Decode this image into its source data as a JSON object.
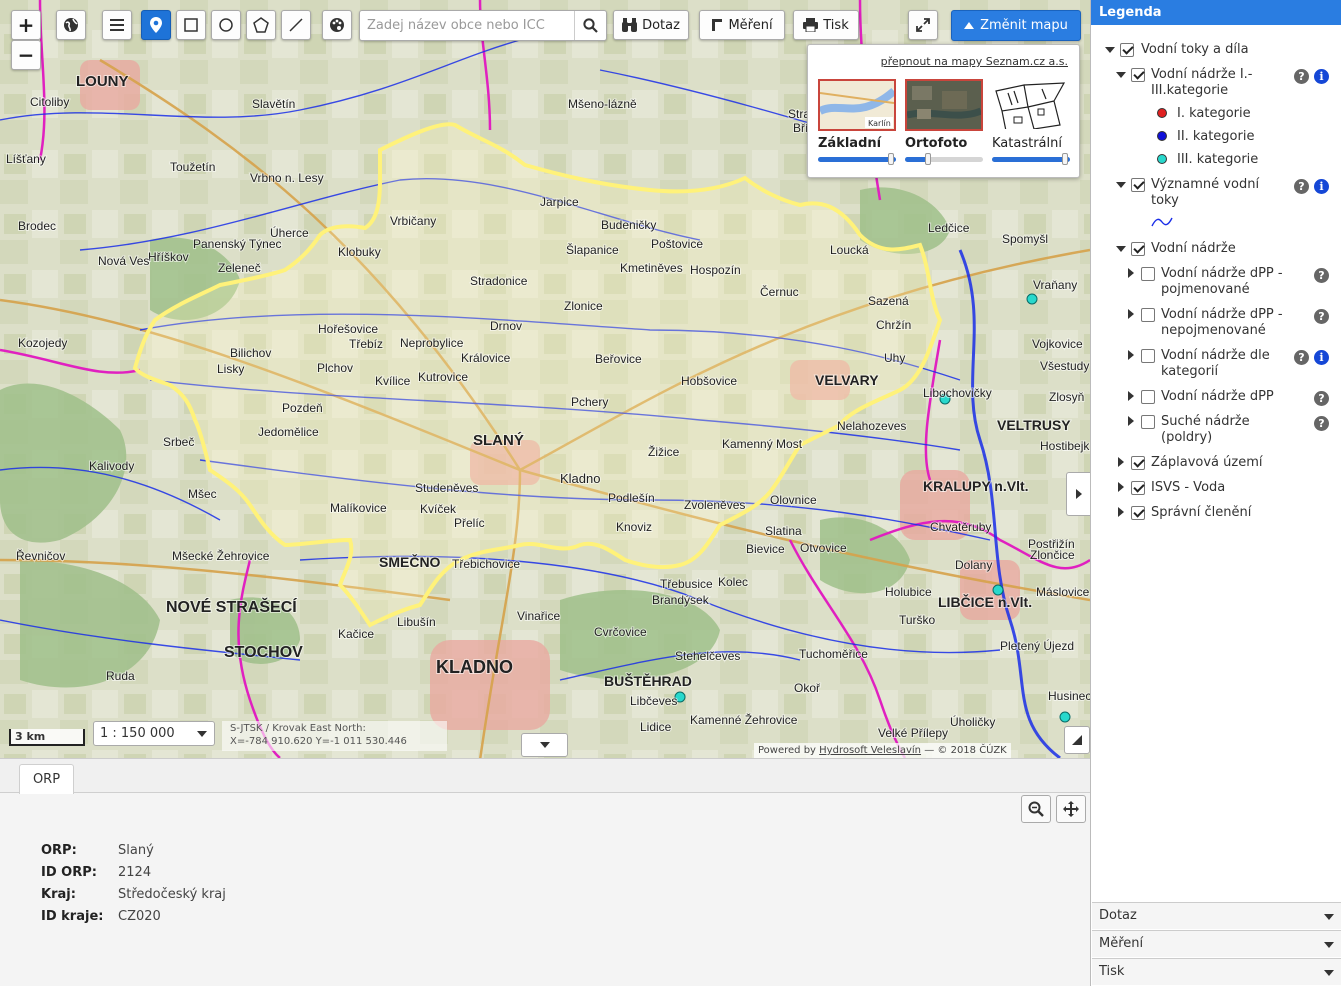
{
  "toolbar": {
    "zoom_in": "+",
    "zoom_out": "−",
    "search_placeholder": "Zadej název obce nebo ICC",
    "query_label": "Dotaz",
    "measure_label": "Měření",
    "print_label": "Tisk",
    "change_map_label": "Změnit mapu"
  },
  "map_switcher": {
    "link": "přepnout na mapy Seznam.cz a.s.",
    "options": [
      {
        "name": "Základní",
        "selected": true,
        "opacity": 1.0,
        "thumb_label": "Karlín"
      },
      {
        "name": "Ortofoto",
        "selected": true,
        "opacity": 0.2
      },
      {
        "name": "Katastrální",
        "selected": false,
        "opacity": 1.0
      }
    ]
  },
  "map": {
    "scale_bar": "3 km",
    "scale": "1 : 150 000",
    "coords_line1": "S-JTSK / Krovak East North:",
    "coords_line2": "X=-784 910.620 Y=-1 011 530.446",
    "powered_prefix": "Powered by",
    "powered_link": "Hydrosoft Veleslavín",
    "powered_suffix": "— © 2018 ČÚZK",
    "place_labels": [
      {
        "text": "LOUNY"
      },
      {
        "text": "Citoliby"
      },
      {
        "text": "Líšťany"
      },
      {
        "text": "Slavětín"
      },
      {
        "text": "Vrbno n. Lesy"
      },
      {
        "text": "Toužetín"
      },
      {
        "text": "Panenský Týnec"
      },
      {
        "text": "Hříškov"
      },
      {
        "text": "Nová Ves"
      },
      {
        "text": "Úherce"
      },
      {
        "text": "Klobuky"
      },
      {
        "text": "Zeleneč"
      },
      {
        "text": "Vrbičany"
      },
      {
        "text": "Jarpice"
      },
      {
        "text": "Šlapanice"
      },
      {
        "text": "Poštovice"
      },
      {
        "text": "Hospozín"
      },
      {
        "text": "Kmetiněves"
      },
      {
        "text": "Loucká"
      },
      {
        "text": "Černuc"
      },
      {
        "text": "Sazená"
      },
      {
        "text": "Chržín"
      },
      {
        "text": "Zlonice"
      },
      {
        "text": "Stradonice"
      },
      {
        "text": "Hořešovice"
      },
      {
        "text": "Neprobylice"
      },
      {
        "text": "Bilichov"
      },
      {
        "text": "Třebíz"
      },
      {
        "text": "Královice"
      },
      {
        "text": "Beřovice"
      },
      {
        "text": "Hobšovice"
      },
      {
        "text": "Pchery"
      },
      {
        "text": "VELVARY"
      },
      {
        "text": "Kvílice"
      },
      {
        "text": "Kutrovice"
      },
      {
        "text": "Pozdeň"
      },
      {
        "text": "Jedomělice"
      },
      {
        "text": "SLANÝ"
      },
      {
        "text": "Kamenný Most"
      },
      {
        "text": "Žižice"
      },
      {
        "text": "Kladno"
      },
      {
        "text": "Podlešín"
      },
      {
        "text": "Zvoleněves"
      },
      {
        "text": "Olovnice"
      },
      {
        "text": "Malíkovice"
      },
      {
        "text": "Studeněves"
      },
      {
        "text": "Přelíc"
      },
      {
        "text": "Kvíček"
      },
      {
        "text": "Knoviz"
      },
      {
        "text": "SMEČNO"
      },
      {
        "text": "Třebichovice"
      },
      {
        "text": "Libušín"
      },
      {
        "text": "Slatina"
      },
      {
        "text": "Otvovice"
      },
      {
        "text": "Bievice"
      },
      {
        "text": "NOVÉ STRAŠECÍ"
      },
      {
        "text": "STOCHOV"
      },
      {
        "text": "KLADNO"
      },
      {
        "text": "BUŠTĚHRAD"
      },
      {
        "text": "Třebusice"
      },
      {
        "text": "Brandýsek"
      },
      {
        "text": "Kolec"
      },
      {
        "text": "Cvrčovice"
      },
      {
        "text": "KRALUPY n.Vlt."
      },
      {
        "text": "LIBČICE n.Vlt."
      },
      {
        "text": "VELTRUSY"
      },
      {
        "text": "Ledčice"
      },
      {
        "text": "Spomyšl"
      },
      {
        "text": "Vraňany"
      },
      {
        "text": "Vojkovice"
      },
      {
        "text": "Chvatěruby"
      },
      {
        "text": "Dolany"
      },
      {
        "text": "Zlončice"
      },
      {
        "text": "Holubice"
      },
      {
        "text": "Turško"
      },
      {
        "text": "Okoř"
      },
      {
        "text": "Velké Přílepy"
      },
      {
        "text": "Úholičky"
      },
      {
        "text": "Husinec"
      },
      {
        "text": "Lidice"
      },
      {
        "text": "Stehelčeves"
      },
      {
        "text": "Vinařice"
      },
      {
        "text": "Kačice"
      },
      {
        "text": "Srbeč"
      },
      {
        "text": "Kalivody"
      },
      {
        "text": "Mšec"
      },
      {
        "text": "Řevničov"
      },
      {
        "text": "Mšecké Žehrovice"
      },
      {
        "text": "Ruda"
      },
      {
        "text": "Kozojedy"
      },
      {
        "text": "Brodec"
      },
      {
        "text": "Lisky"
      },
      {
        "text": "Plchov"
      },
      {
        "text": "Drnov"
      },
      {
        "text": "Nelahozeves"
      },
      {
        "text": "Uhy"
      },
      {
        "text": "Mšeno-lázně"
      },
      {
        "text": "Straškov"
      },
      {
        "text": "Bříza"
      },
      {
        "text": "Budeničky"
      },
      {
        "text": "Zlosyň"
      },
      {
        "text": "Všestudy"
      },
      {
        "text": "Hostibejk"
      },
      {
        "text": "Postřižín"
      },
      {
        "text": "Máslovice"
      },
      {
        "text": "Libčeves"
      },
      {
        "text": "Kamenné Žehrovice"
      },
      {
        "text": "Pletený Újezd"
      },
      {
        "text": "Tuchoměřice"
      },
      {
        "text": "Libochovičky"
      }
    ]
  },
  "bottom_panel": {
    "tab": "ORP",
    "rows": [
      {
        "key": "ORP",
        "value": "Slaný"
      },
      {
        "key": "ID ORP",
        "value": "2124"
      },
      {
        "key": "Kraj",
        "value": "Středočeský kraj"
      },
      {
        "key": "ID kraje",
        "value": "CZ020"
      }
    ]
  },
  "legend": {
    "title": "Legenda",
    "items": [
      {
        "label": "Vodní toky a díla"
      },
      {
        "label": "Vodní nádrže I.-III.kategorie"
      },
      {
        "label": "I. kategorie",
        "color": "#e02020"
      },
      {
        "label": "II. kategorie",
        "color": "#1010d8"
      },
      {
        "label": "III. kategorie",
        "color": "#28d8cc"
      },
      {
        "label": "Významné vodní toky"
      },
      {
        "label": "Vodní nádrže"
      },
      {
        "label": "Vodní nádrže dPP - pojmenované"
      },
      {
        "label": "Vodní nádrže dPP - nepojmenované"
      },
      {
        "label": "Vodní nádrže dle kategorií"
      },
      {
        "label": "Vodní nádrže dPP"
      },
      {
        "label": "Suché nádrže (poldry)"
      },
      {
        "label": "Záplavová území"
      },
      {
        "label": "ISVS - Voda"
      },
      {
        "label": "Správní členění"
      }
    ],
    "info_glyph": "i",
    "help_glyph": "?",
    "accordion": [
      "Dotaz",
      "Měření",
      "Tisk"
    ]
  },
  "colors": {
    "accent": "#2a7de1",
    "boundary": "#fff27a",
    "admin_border": "#e020c0",
    "river": "#1a2ee8"
  }
}
